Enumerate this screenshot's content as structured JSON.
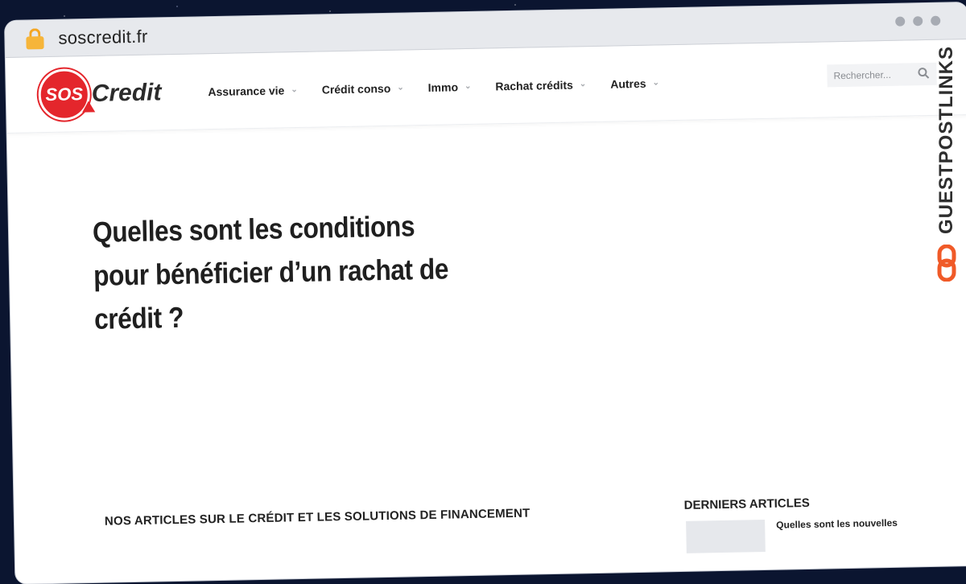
{
  "browser": {
    "url": "soscredit.fr"
  },
  "logo": {
    "badge_text": "SOS",
    "word": "Credit",
    "brand_color": "#e4262c"
  },
  "nav": {
    "items": [
      {
        "label": "Assurance vie"
      },
      {
        "label": "Crédit conso"
      },
      {
        "label": "Immo"
      },
      {
        "label": "Rachat crédits"
      },
      {
        "label": "Autres"
      }
    ]
  },
  "search": {
    "placeholder": "Rechercher..."
  },
  "hero": {
    "title": "Quelles sont les conditions pour bénéficier d’un rachat de crédit ?"
  },
  "sections": {
    "articles_title": "NOS ARTICLES SUR LE CRÉDIT ET LES SOLUTIONS DE FINANCEMENT",
    "latest_title": "DERNIERS ARTICLES",
    "latest_first": "Quelles sont les nouvelles"
  },
  "watermark": {
    "text": "GUESTPOSTLINKS",
    "accent_color": "#f05a28"
  }
}
